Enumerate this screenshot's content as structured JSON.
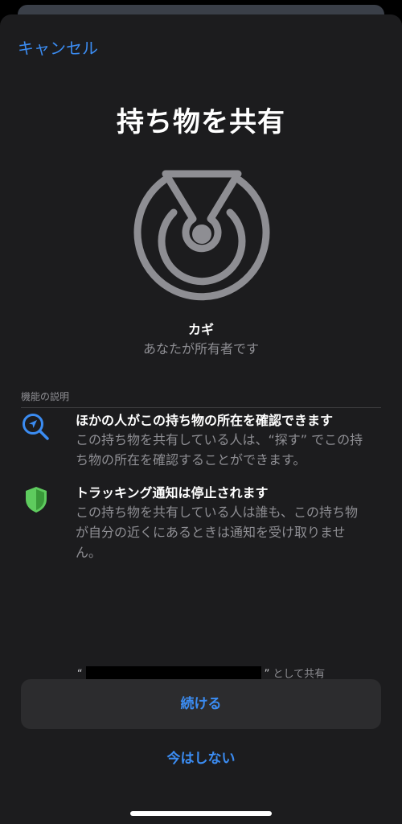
{
  "header": {
    "cancel_label": "キャンセル"
  },
  "title": "持ち物を共有",
  "item": {
    "name": "カギ",
    "subtitle": "あなたが所有者です",
    "icon": "airtag-key-icon"
  },
  "section_label": "機能の説明",
  "features": [
    {
      "icon": "magnifier-location-icon",
      "title": "ほかの人がこの持ち物の所在を確認できます",
      "description": "この持ち物を共有している人は、“探す” でこの持ち物の所在を確認することができます。"
    },
    {
      "icon": "shield-icon",
      "title": "トラッキング通知は停止されます",
      "description": "この持ち物を共有している人は誰も、この持ち物が自分の近くにあるときは通知を受け取りません。"
    }
  ],
  "share_as": {
    "open_quote": "“",
    "close_quote": "”",
    "suffix": "として共有"
  },
  "buttons": {
    "continue": "続ける",
    "not_now": "今はしない"
  },
  "colors": {
    "accent": "#3b8cf2",
    "shield": "#5ecb5e",
    "sheet_bg": "#1c1c1e",
    "button_bg": "#2c2c2e"
  }
}
